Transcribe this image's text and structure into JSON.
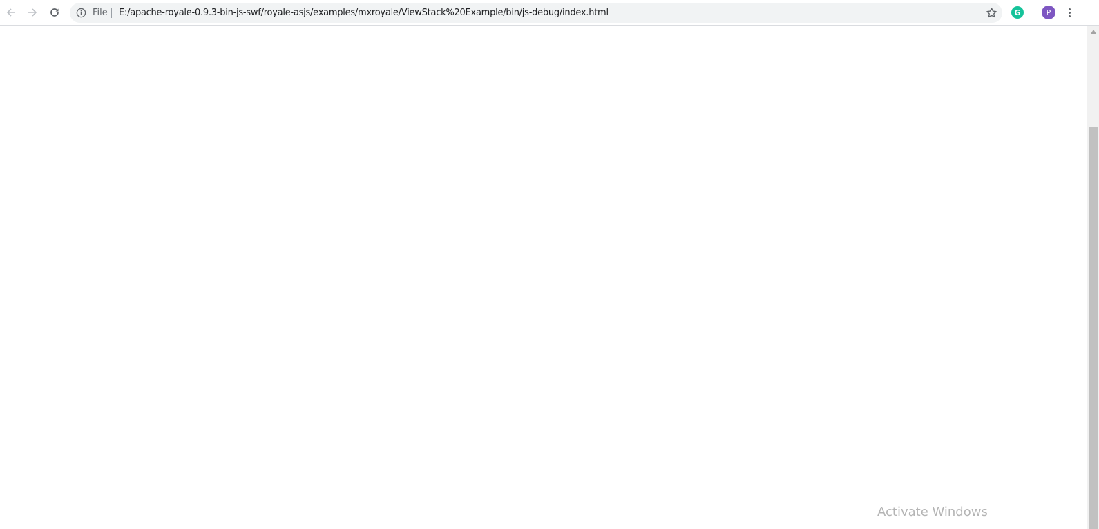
{
  "browser": {
    "scheme_label": "File",
    "url": "E:/apache-royale-0.9.3-bin-js-swf/royale-asjs/examples/mxroyale/ViewStack%20Example/bin/js-debug/index.html",
    "extension_letter": "G",
    "profile_initial": "P",
    "icons": [
      "back-arrow-icon",
      "forward-arrow-icon",
      "reload-icon",
      "info-icon",
      "star-icon",
      "grammarly-icon",
      "kebab-menu-icon"
    ],
    "colors": {
      "toolbar_bg": "#ffffff",
      "omnibox_bg": "#f1f3f4",
      "grammarly": "#15c39a",
      "avatar": "#7e57c2",
      "watermark": "#b4b4b4"
    }
  },
  "os": {
    "watermark": "Activate Windows"
  }
}
